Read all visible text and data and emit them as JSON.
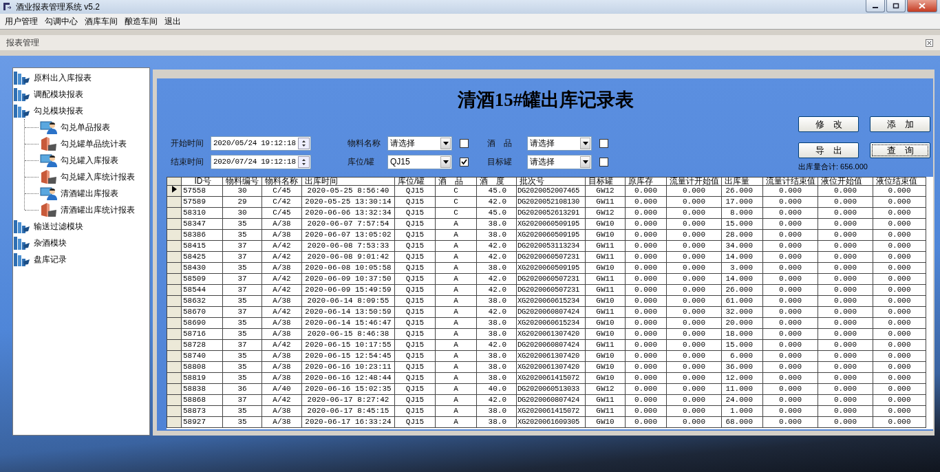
{
  "window": {
    "title": "酒业报表管理系统 v5.2"
  },
  "menu": [
    "用户管理",
    "勾调中心",
    "酒库车间",
    "酿造车间",
    "退出"
  ],
  "panel_title": "报表管理",
  "tree": [
    {
      "label": "原料出入库报表"
    },
    {
      "label": "调配模块报表"
    },
    {
      "label": "勾兑模块报表",
      "children": [
        {
          "label": "勾兑单品报表",
          "kind": "user"
        },
        {
          "label": "勾兑罐单品统计表",
          "kind": "box"
        },
        {
          "label": "勾兑罐入库报表",
          "kind": "user"
        },
        {
          "label": "勾兑罐入库统计报表",
          "kind": "box"
        },
        {
          "label": "清酒罐出库报表",
          "kind": "user"
        },
        {
          "label": "清酒罐出库统计报表",
          "kind": "box"
        }
      ]
    },
    {
      "label": "输送过滤模块"
    },
    {
      "label": "杂酒模块"
    },
    {
      "label": "盘库记录"
    }
  ],
  "report": {
    "title": "清酒15#罐出库记录表",
    "filters": [
      {
        "label": "开始时间",
        "kind": "datetime",
        "value": "2020/05/24 19:12:18"
      },
      {
        "label": "物料名称",
        "kind": "select",
        "value": "请选择",
        "checked": false
      },
      {
        "label": "酒　品",
        "kind": "select",
        "value": "请选择",
        "checked": false
      },
      {
        "label": "结束时间",
        "kind": "datetime",
        "value": "2020/07/24 19:12:18"
      },
      {
        "label": "库位/罐",
        "kind": "select",
        "value": "QJ15",
        "checked": true
      },
      {
        "label": "目标罐",
        "kind": "select",
        "value": "请选择",
        "checked": false
      }
    ],
    "buttons": [
      {
        "label": "修　改",
        "focused": false
      },
      {
        "label": "添　加",
        "focused": false
      },
      {
        "label": "导　出",
        "focused": false
      },
      {
        "label": "查　询",
        "focused": true
      }
    ],
    "total": "出库量合计: 656.000",
    "table": {
      "columns": [
        "ID号",
        "物料编号",
        "物料名称",
        "出库时间",
        "库位/罐",
        "酒　品",
        "酒　度",
        "批次号",
        "目标罐",
        "原库存",
        "流量计开始值",
        "出库量",
        "流量计结束值",
        "液位开始值",
        "液位结束值"
      ],
      "rows": [
        {
          "selected": true,
          "cells": [
            "57558",
            "30",
            "C/45",
            "2020-05-25 8:56:40",
            "QJ15",
            "C",
            "45.0",
            "DG2020052007465",
            "GW12",
            "0.000",
            "0.000",
            "26.000",
            "0.000",
            "0.000",
            "0.000"
          ]
        },
        {
          "selected": false,
          "cells": [
            "57589",
            "29",
            "C/42",
            "2020-05-25 13:30:14",
            "QJ15",
            "C",
            "42.0",
            "DG2020052108130",
            "GW11",
            "0.000",
            "0.000",
            "17.000",
            "0.000",
            "0.000",
            "0.000"
          ]
        },
        {
          "selected": false,
          "cells": [
            "58310",
            "30",
            "C/45",
            "2020-06-06 13:32:34",
            "QJ15",
            "C",
            "45.0",
            "DG2020052613291",
            "GW12",
            "0.000",
            "0.000",
            "8.000",
            "0.000",
            "0.000",
            "0.000"
          ]
        },
        {
          "selected": false,
          "cells": [
            "58347",
            "35",
            "A/38",
            "2020-06-07 7:57:54",
            "QJ15",
            "A",
            "38.0",
            "XG2020060509195",
            "GW10",
            "0.000",
            "0.000",
            "15.000",
            "0.000",
            "0.000",
            "0.000"
          ]
        },
        {
          "selected": false,
          "cells": [
            "58386",
            "35",
            "A/38",
            "2020-06-07 13:05:02",
            "QJ15",
            "A",
            "38.0",
            "XG2020060509195",
            "GW10",
            "0.000",
            "0.000",
            "28.000",
            "0.000",
            "0.000",
            "0.000"
          ]
        },
        {
          "selected": false,
          "cells": [
            "58415",
            "37",
            "A/42",
            "2020-06-08 7:53:33",
            "QJ15",
            "A",
            "42.0",
            "DG2020053113234",
            "GW11",
            "0.000",
            "0.000",
            "34.000",
            "0.000",
            "0.000",
            "0.000"
          ]
        },
        {
          "selected": false,
          "cells": [
            "58425",
            "37",
            "A/42",
            "2020-06-08 9:01:42",
            "QJ15",
            "A",
            "42.0",
            "DG2020060507231",
            "GW11",
            "0.000",
            "0.000",
            "14.000",
            "0.000",
            "0.000",
            "0.000"
          ]
        },
        {
          "selected": false,
          "cells": [
            "58430",
            "35",
            "A/38",
            "2020-06-08 10:05:58",
            "QJ15",
            "A",
            "38.0",
            "XG2020060509195",
            "GW10",
            "0.000",
            "0.000",
            "3.000",
            "0.000",
            "0.000",
            "0.000"
          ]
        },
        {
          "selected": false,
          "cells": [
            "58509",
            "37",
            "A/42",
            "2020-06-09 10:37:50",
            "QJ15",
            "A",
            "42.0",
            "DG2020060507231",
            "GW11",
            "0.000",
            "0.000",
            "14.000",
            "0.000",
            "0.000",
            "0.000"
          ]
        },
        {
          "selected": false,
          "cells": [
            "58544",
            "37",
            "A/42",
            "2020-06-09 15:49:59",
            "QJ15",
            "A",
            "42.0",
            "DG2020060507231",
            "GW11",
            "0.000",
            "0.000",
            "26.000",
            "0.000",
            "0.000",
            "0.000"
          ]
        },
        {
          "selected": false,
          "cells": [
            "58632",
            "35",
            "A/38",
            "2020-06-14 8:09:55",
            "QJ15",
            "A",
            "38.0",
            "XG2020060615234",
            "GW10",
            "0.000",
            "0.000",
            "61.000",
            "0.000",
            "0.000",
            "0.000"
          ]
        },
        {
          "selected": false,
          "cells": [
            "58670",
            "37",
            "A/42",
            "2020-06-14 13:50:59",
            "QJ15",
            "A",
            "42.0",
            "DG2020060807424",
            "GW11",
            "0.000",
            "0.000",
            "32.000",
            "0.000",
            "0.000",
            "0.000"
          ]
        },
        {
          "selected": false,
          "cells": [
            "58690",
            "35",
            "A/38",
            "2020-06-14 15:46:47",
            "QJ15",
            "A",
            "38.0",
            "XG2020060615234",
            "GW10",
            "0.000",
            "0.000",
            "20.000",
            "0.000",
            "0.000",
            "0.000"
          ]
        },
        {
          "selected": false,
          "cells": [
            "58716",
            "35",
            "A/38",
            "2020-06-15 8:46:38",
            "QJ15",
            "A",
            "38.0",
            "XG2020061307420",
            "GW10",
            "0.000",
            "0.000",
            "18.000",
            "0.000",
            "0.000",
            "0.000"
          ]
        },
        {
          "selected": false,
          "cells": [
            "58728",
            "37",
            "A/42",
            "2020-06-15 10:17:55",
            "QJ15",
            "A",
            "42.0",
            "DG2020060807424",
            "GW11",
            "0.000",
            "0.000",
            "15.000",
            "0.000",
            "0.000",
            "0.000"
          ]
        },
        {
          "selected": false,
          "cells": [
            "58740",
            "35",
            "A/38",
            "2020-06-15 12:54:45",
            "QJ15",
            "A",
            "38.0",
            "XG2020061307420",
            "GW10",
            "0.000",
            "0.000",
            "6.000",
            "0.000",
            "0.000",
            "0.000"
          ]
        },
        {
          "selected": false,
          "cells": [
            "58808",
            "35",
            "A/38",
            "2020-06-16 10:23:11",
            "QJ15",
            "A",
            "38.0",
            "XG2020061307420",
            "GW10",
            "0.000",
            "0.000",
            "36.000",
            "0.000",
            "0.000",
            "0.000"
          ]
        },
        {
          "selected": false,
          "cells": [
            "58819",
            "35",
            "A/38",
            "2020-06-16 12:48:44",
            "QJ15",
            "A",
            "38.0",
            "XG2020061415072",
            "GW10",
            "0.000",
            "0.000",
            "12.000",
            "0.000",
            "0.000",
            "0.000"
          ]
        },
        {
          "selected": false,
          "cells": [
            "58838",
            "36",
            "A/40",
            "2020-06-16 15:02:35",
            "QJ15",
            "A",
            "40.0",
            "DG2020060513033",
            "GW12",
            "0.000",
            "0.000",
            "11.000",
            "0.000",
            "0.000",
            "0.000"
          ]
        },
        {
          "selected": false,
          "cells": [
            "58868",
            "37",
            "A/42",
            "2020-06-17 8:27:42",
            "QJ15",
            "A",
            "42.0",
            "DG2020060807424",
            "GW11",
            "0.000",
            "0.000",
            "24.000",
            "0.000",
            "0.000",
            "0.000"
          ]
        },
        {
          "selected": false,
          "cells": [
            "58873",
            "35",
            "A/38",
            "2020-06-17 8:45:15",
            "QJ15",
            "A",
            "38.0",
            "XG2020061415072",
            "GW11",
            "0.000",
            "0.000",
            "1.000",
            "0.000",
            "0.000",
            "0.000"
          ]
        },
        {
          "selected": false,
          "cells": [
            "58927",
            "35",
            "A/38",
            "2020-06-17 16:33:24",
            "QJ15",
            "A",
            "38.0",
            "XG2020061609305",
            "GW10",
            "0.000",
            "0.000",
            "68.000",
            "0.000",
            "0.000",
            "0.000"
          ]
        }
      ]
    }
  }
}
